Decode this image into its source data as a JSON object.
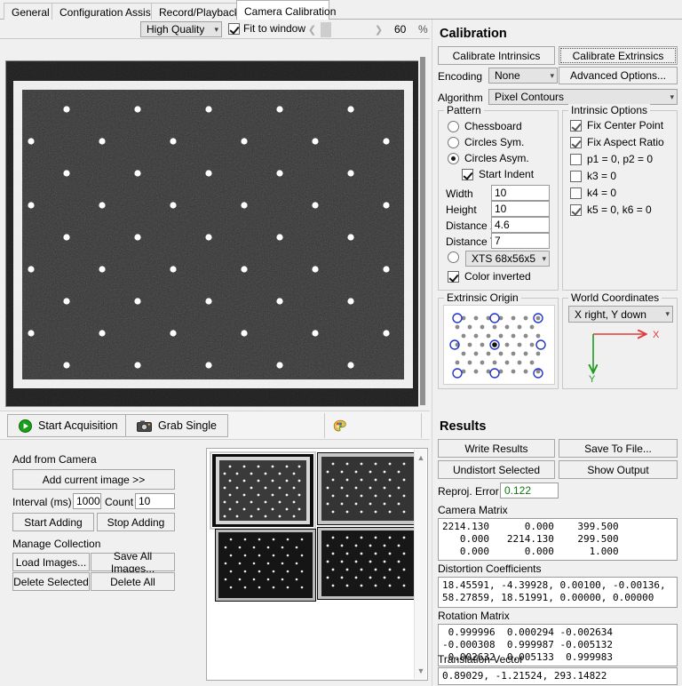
{
  "window": {
    "tabs": [
      {
        "label": "General",
        "active": false
      },
      {
        "label": "Configuration Assistant",
        "active": false
      },
      {
        "label": "Record/Playback",
        "active": false
      },
      {
        "label": "Camera Calibration",
        "active": true
      }
    ]
  },
  "toolbar": {
    "quality": "High Quality",
    "fit_to_window_label": "Fit to window",
    "fit_to_window_checked": true,
    "zoom_value": "60",
    "zoom_unit": "%",
    "prev_icon": "chevron-left-icon",
    "next_icon": "chevron-right-icon"
  },
  "acquisition": {
    "start_label": "Start Acquisition",
    "start_icon": "play-icon",
    "grab_label": "Grab Single",
    "grab_icon": "camera-icon",
    "palette_icon": "color-palette-icon"
  },
  "add_from_camera": {
    "section_label": "Add from Camera",
    "add_current_label": "Add current image >>",
    "interval_label": "Interval (ms)",
    "interval_value": "1000",
    "count_label": "Count",
    "count_value": "10",
    "start_adding_label": "Start Adding",
    "stop_adding_label": "Stop Adding"
  },
  "manage_collection": {
    "section_label": "Manage Collection",
    "load_images_label": "Load Images...",
    "save_all_images_label": "Save All Images...",
    "delete_selected_label": "Delete Selected",
    "delete_all_label": "Delete All"
  },
  "gallery": {
    "scroll_up_icon": "chevron-up-icon",
    "scroll_down_icon": "chevron-down-icon",
    "items": [
      {
        "name": "thumbnail-1",
        "selected": true
      },
      {
        "name": "thumbnail-2",
        "selected": false
      },
      {
        "name": "thumbnail-3",
        "selected": false
      },
      {
        "name": "thumbnail-4",
        "selected": false
      }
    ]
  },
  "calibration": {
    "title": "Calibration",
    "calibrate_intrinsics_label": "Calibrate Intrinsics",
    "calibrate_extrinsics_label": "Calibrate Extrinsics",
    "encoding_label": "Encoding",
    "encoding_value": "None",
    "advanced_options_label": "Advanced Options...",
    "algorithm_label": "Algorithm",
    "algorithm_value": "Pixel Contours"
  },
  "pattern": {
    "title": "Pattern",
    "options": [
      {
        "label": "Chessboard",
        "selected": false
      },
      {
        "label": "Circles Sym.",
        "selected": false
      },
      {
        "label": "Circles Asym.",
        "selected": true
      }
    ],
    "start_indent_label": "Start Indent",
    "start_indent_checked": true,
    "width_label": "Width",
    "width_value": "10",
    "height_label": "Height",
    "height_value": "10",
    "distance_x_label": "Distance X",
    "distance_x_value": "4.6",
    "distance_y_label": "Distance Y",
    "distance_y_value": "7",
    "preset_selected": false,
    "preset_value": "XTS 68x56x5",
    "color_inverted_label": "Color inverted",
    "color_inverted_checked": true
  },
  "intrinsic_options": {
    "title": "Intrinsic Options",
    "items": [
      {
        "label": "Fix Center Point",
        "checked": true
      },
      {
        "label": "Fix Aspect Ratio",
        "checked": true
      },
      {
        "label": "p1 = 0, p2 = 0",
        "checked": false
      },
      {
        "label": "k3 = 0",
        "checked": false
      },
      {
        "label": "k4 = 0",
        "checked": false
      },
      {
        "label": "k5 = 0, k6 = 0",
        "checked": true
      }
    ]
  },
  "extrinsic_origin": {
    "title": "Extrinsic Origin"
  },
  "world_coordinates": {
    "title": "World Coordinates",
    "value": "X right, Y down",
    "x_axis_label": "X",
    "y_axis_label": "Y",
    "x_axis_color": "#e03a3a",
    "y_axis_color": "#1f9b1f"
  },
  "results": {
    "title": "Results",
    "write_results_label": "Write Results",
    "save_to_file_label": "Save To File...",
    "undistort_selected_label": "Undistort Selected",
    "show_output_label": "Show Output",
    "reproj_error_label": "Reproj. Error",
    "reproj_error_value": "0.122",
    "reproj_error_color": "#127a12",
    "camera_matrix_label": "Camera Matrix",
    "camera_matrix": "2214.130      0.000    399.500\n   0.000   2214.130    299.500\n   0.000      0.000      1.000",
    "distortion_label": "Distortion Coefficients",
    "distortion": "18.45591, -4.39928, 0.00100, -0.00136,\n58.27859, 18.51991, 0.00000, 0.00000",
    "rotation_label": "Rotation Matrix",
    "rotation": " 0.999996  0.000294 -0.002634\n-0.000308  0.999987 -0.005132\n 0.002632  0.005133  0.999983",
    "translation_label": "Translation Vector",
    "translation": "0.89029, -1.21524, 293.14822"
  }
}
